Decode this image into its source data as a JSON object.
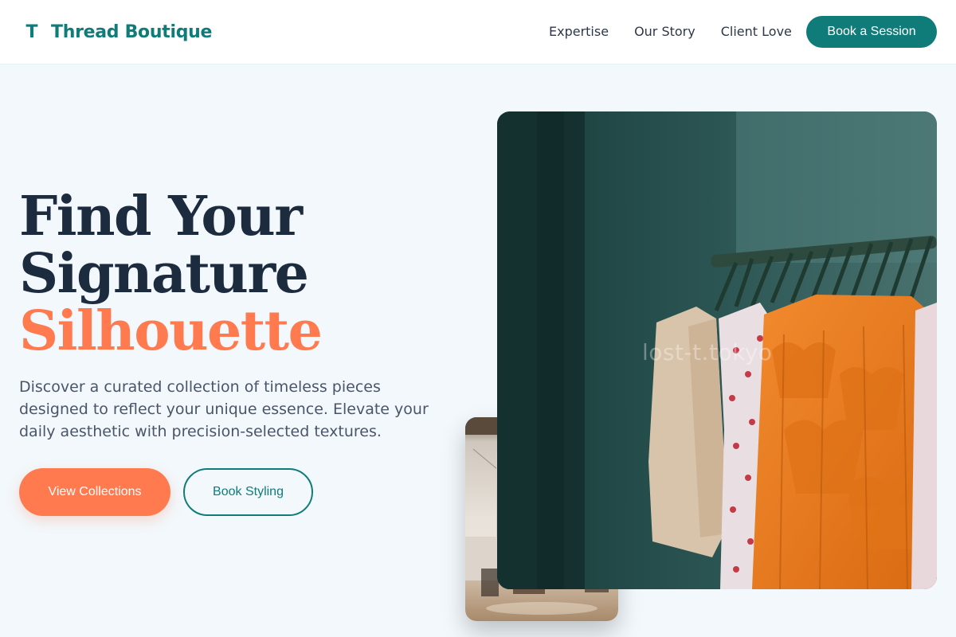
{
  "brand": {
    "mark": "T",
    "name": "Thread Boutique",
    "accent_color": "#0f7c7a",
    "highlight_color": "#ff7a4f"
  },
  "nav": {
    "items": [
      {
        "label": "Expertise"
      },
      {
        "label": "Our Story"
      },
      {
        "label": "Client Love"
      }
    ],
    "cta": "Book a Session"
  },
  "hero": {
    "title_line1": "Find Your",
    "title_line2": "Signature",
    "title_accent": "Silhouette",
    "description": "Discover a curated collection of timeless pieces designed to reflect your unique essence. Elevate your daily aesthetic with precision-selected textures.",
    "primary_button": "View Collections",
    "secondary_button": "Book Styling"
  },
  "images": {
    "main": {
      "icon": "clothing-rack-photo",
      "watermark": "lost-t.tokyo"
    },
    "secondary": {
      "icon": "store-interior-photo"
    }
  }
}
